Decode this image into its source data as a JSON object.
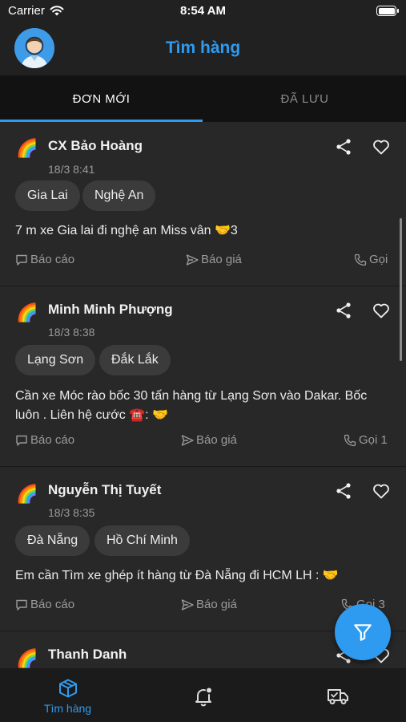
{
  "status_bar": {
    "carrier": "Carrier",
    "time": "8:54 AM"
  },
  "header": {
    "title": "Tìm hàng",
    "avatar_icon": "user-avatar-icon"
  },
  "tabs": [
    {
      "label": "ĐƠN MỚI",
      "active": true
    },
    {
      "label": "ĐÃ LƯU",
      "active": false
    }
  ],
  "posts": [
    {
      "name": "CX Bảo Hoàng",
      "time": "18/3 8:41",
      "origin": "Gia Lai",
      "destination": "Nghệ An",
      "content": "7 m xe Gia lai đi nghệ an Miss vân 🤝3",
      "report": "Báo cáo",
      "quote": "Báo giá",
      "call": "Gọi"
    },
    {
      "name": "Minh Minh Phượng",
      "time": "18/3 8:38",
      "origin": "Lạng Sơn",
      "destination": "Đắk Lắk",
      "content": "Cần xe Móc rào bốc 30 tấn hàng từ Lạng Sơn vào Dakar. Bốc luôn . Liên hệ cước ☎️: 🤝",
      "report": "Báo cáo",
      "quote": "Báo giá",
      "call": "Gọi 1"
    },
    {
      "name": "Nguyễn Thị Tuyết",
      "time": "18/3 8:35",
      "origin": "Đà Nẵng",
      "destination": "Hồ Chí Minh",
      "content": "Em cần Tìm xe ghép ít hàng từ Đà Nẵng đi HCM LH : 🤝",
      "report": "Báo cáo",
      "quote": "Báo giá",
      "call": "Gọi 3"
    },
    {
      "name": "Thanh Danh"
    }
  ],
  "post_emoji": "🌈",
  "fab": {
    "icon": "filter-icon"
  },
  "bottom_nav": [
    {
      "label": "Tìm hàng",
      "icon": "box-icon",
      "active": true
    },
    {
      "label": "",
      "icon": "bell-icon",
      "active": false
    },
    {
      "label": "",
      "icon": "truck-icon",
      "active": false
    }
  ],
  "colors": {
    "accent": "#2e9bf0",
    "background": "#212121",
    "card": "#282828",
    "chip": "#3b3b3b"
  }
}
